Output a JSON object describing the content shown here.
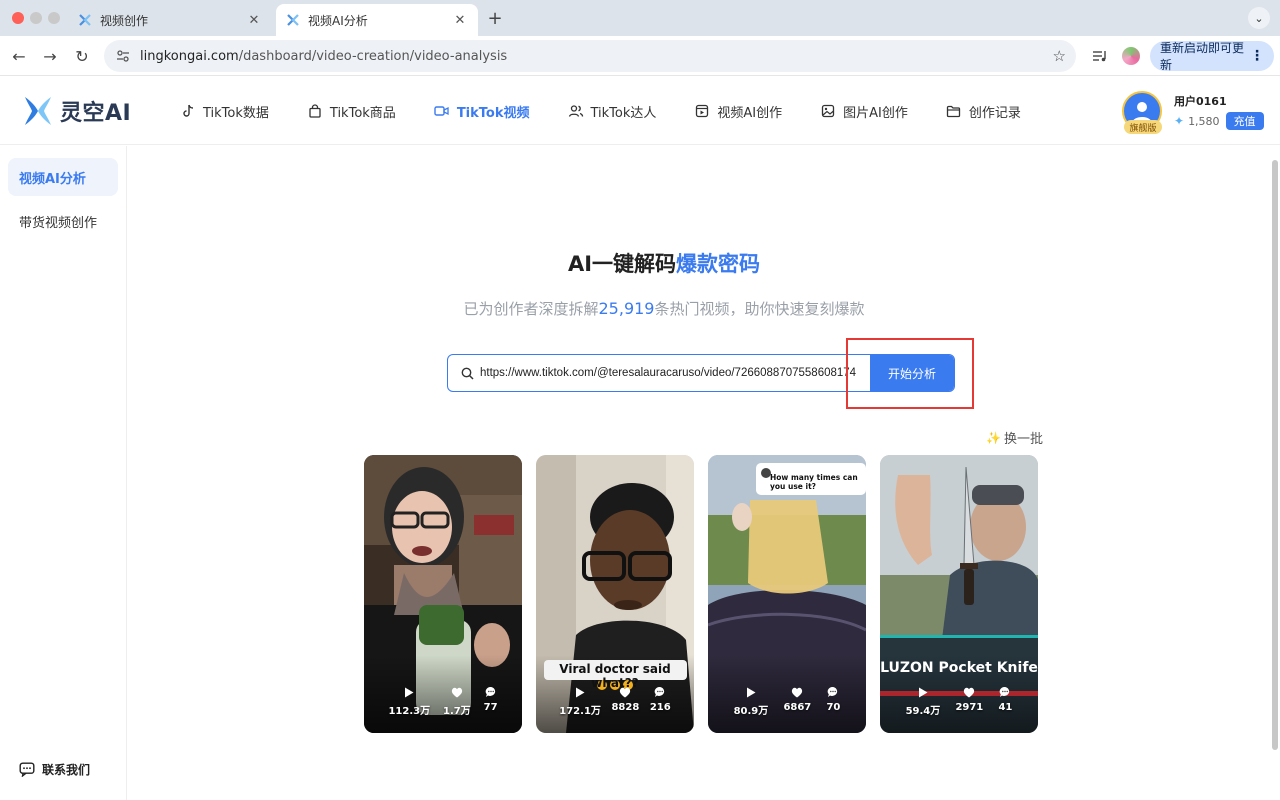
{
  "browser": {
    "tabs": [
      {
        "title": "视频创作"
      },
      {
        "title": "视频AI分析"
      }
    ],
    "url_host": "lingkongai.com",
    "url_path": "/dashboard/video-creation/video-analysis",
    "update_label": "重新启动即可更新"
  },
  "header": {
    "logo_text": "灵空AI",
    "nav": [
      {
        "label": "TikTok数据",
        "icon": "tiktok-icon"
      },
      {
        "label": "TikTok商品",
        "icon": "shopping-bag-icon"
      },
      {
        "label": "TikTok视频",
        "icon": "video-camera-icon",
        "active": true
      },
      {
        "label": "TikTok达人",
        "icon": "users-icon"
      },
      {
        "label": "视频AI创作",
        "icon": "video-frame-icon"
      },
      {
        "label": "图片AI创作",
        "icon": "image-icon"
      },
      {
        "label": "创作记录",
        "icon": "folder-icon"
      }
    ],
    "user": {
      "name": "用户0161",
      "badge": "旗舰版",
      "credits": "1,580",
      "recharge_label": "充值"
    }
  },
  "sidebar": {
    "items": [
      {
        "label": "视频AI分析",
        "active": true
      },
      {
        "label": "带货视频创作"
      }
    ],
    "contact_label": "联系我们"
  },
  "main": {
    "title_prefix": "AI一键解码",
    "title_accent": "爆款密码",
    "subtitle_prefix": "已为创作者深度拆解",
    "subtitle_number": "25,919",
    "subtitle_suffix": "条热门视频，助你快速复刻爆款",
    "search_value": "https://www.tiktok.com/@teresalauracaruso/video/7266088707558608174",
    "search_button": "开始分析",
    "refresh_label": "换一批",
    "videos": [
      {
        "plays": "112.3万",
        "likes": "1.7万",
        "comments": "77",
        "caption": ""
      },
      {
        "plays": "172.1万",
        "likes": "8828",
        "comments": "216",
        "caption": "Viral doctor said what??"
      },
      {
        "plays": "80.9万",
        "likes": "6867",
        "comments": "70",
        "caption": "How many times can you use it?"
      },
      {
        "plays": "59.4万",
        "likes": "2971",
        "comments": "41",
        "caption": "LUZON Pocket Knife"
      }
    ]
  },
  "colors": {
    "accent": "#3b7bf0",
    "highlight_box": "#e53935"
  }
}
